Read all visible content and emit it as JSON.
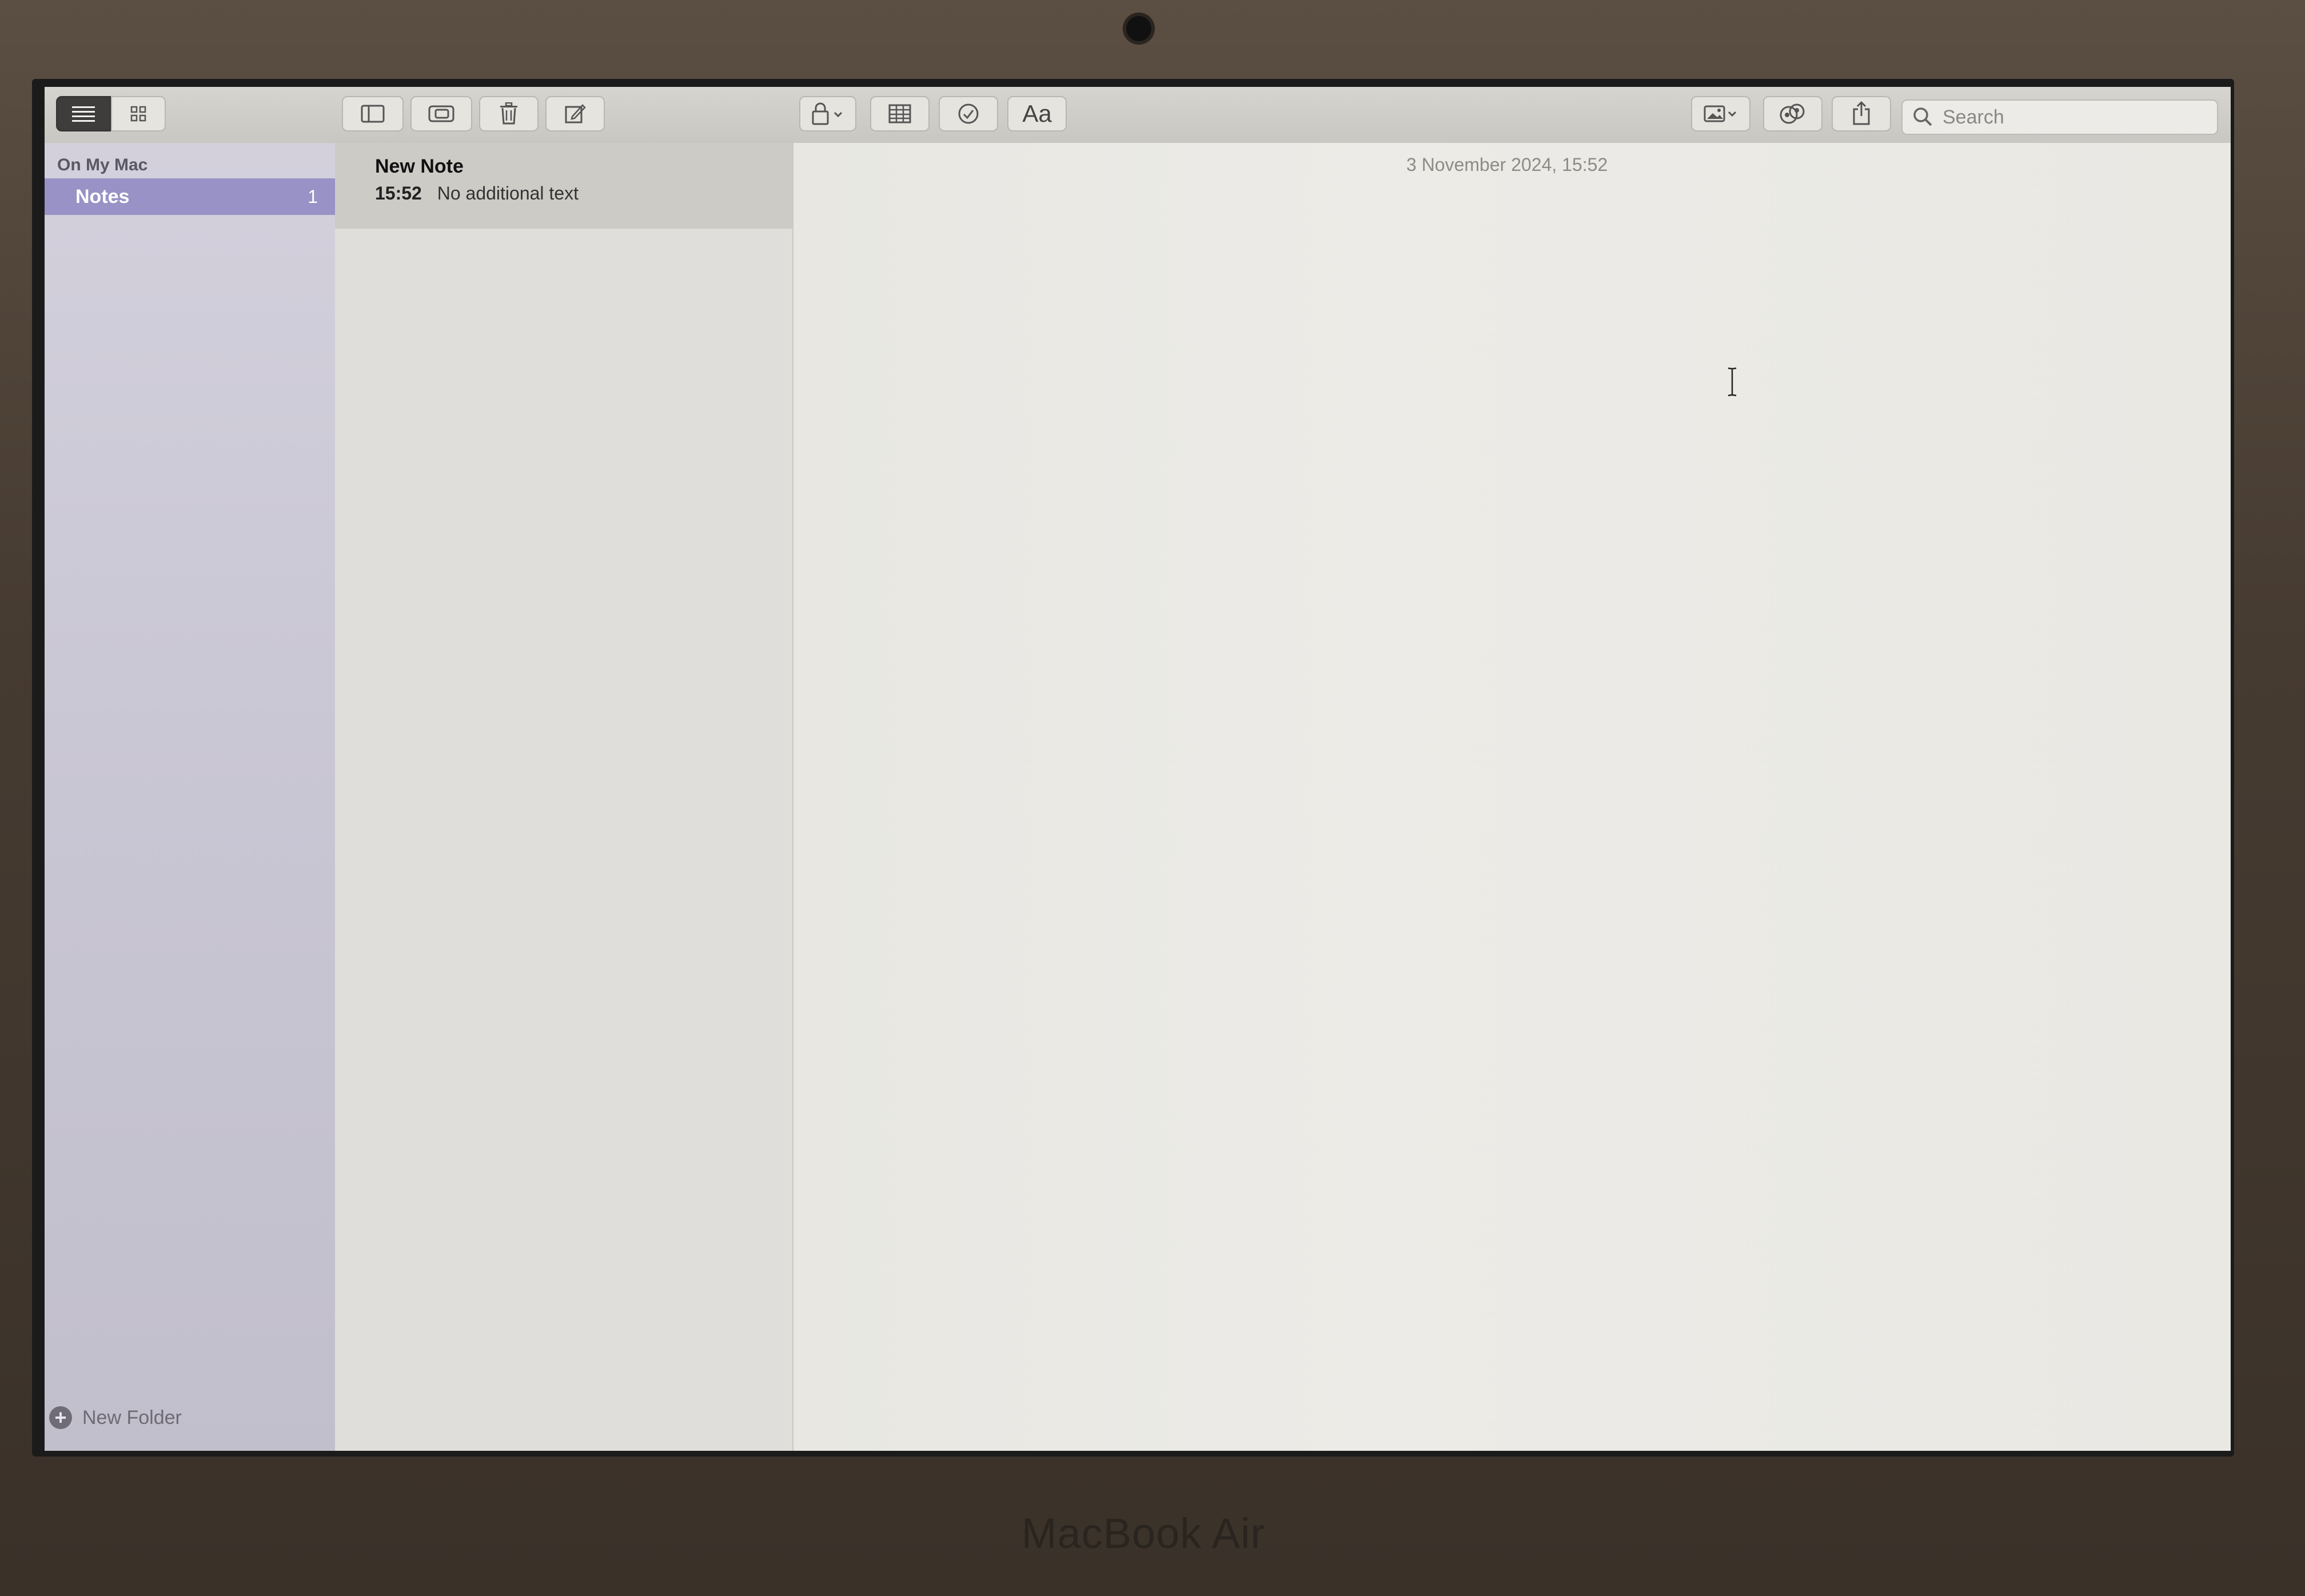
{
  "device": {
    "brand_label": "MacBook Air"
  },
  "toolbar": {
    "view_list_label": "list view",
    "view_gallery_label": "gallery view",
    "font_label": "Aa",
    "search_placeholder": "Search"
  },
  "sidebar": {
    "section_header": "On My Mac",
    "folders": [
      {
        "name": "Notes",
        "count": "1"
      }
    ],
    "new_folder_label": "New Folder"
  },
  "notes": [
    {
      "title": "New Note",
      "time": "15:52",
      "preview": "No additional text"
    }
  ],
  "editor": {
    "date_label": "3 November 2024, 15:52"
  },
  "colors": {
    "selected_folder": "#9892c6",
    "sidebar_bg": "#cbc8d6",
    "selected_note": "#cdcbc6"
  }
}
